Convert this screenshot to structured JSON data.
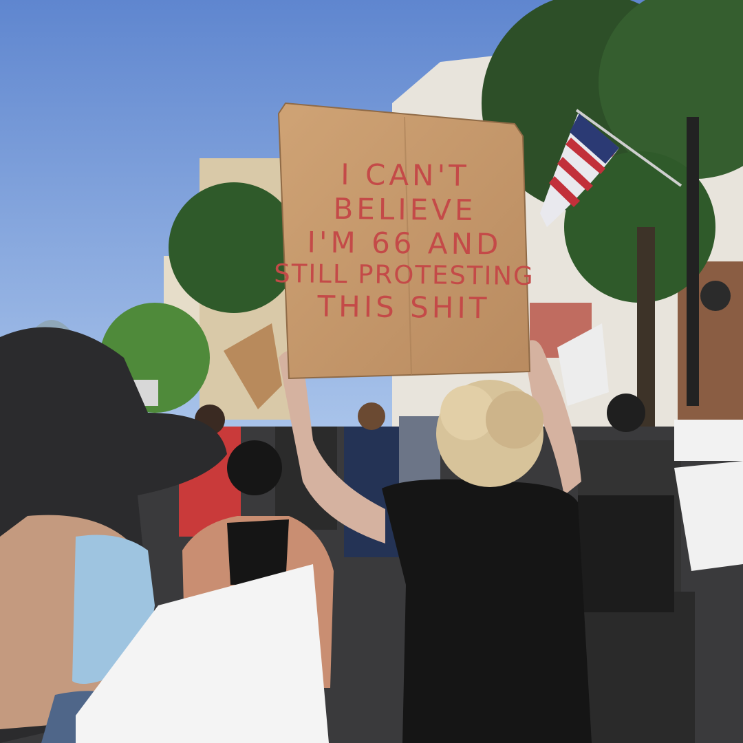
{
  "sign": {
    "lines": [
      "I CAN'T",
      "BELIEVE",
      "I'M 66 AND",
      "STILL PROTESTING",
      "THIS SHIT"
    ],
    "text_color": "#c44a48",
    "cardboard_color": "#c79a6e"
  },
  "colors": {
    "sky": "#6f94d6",
    "foliage": "#2f5a2a",
    "street": "#3a3a3c"
  }
}
